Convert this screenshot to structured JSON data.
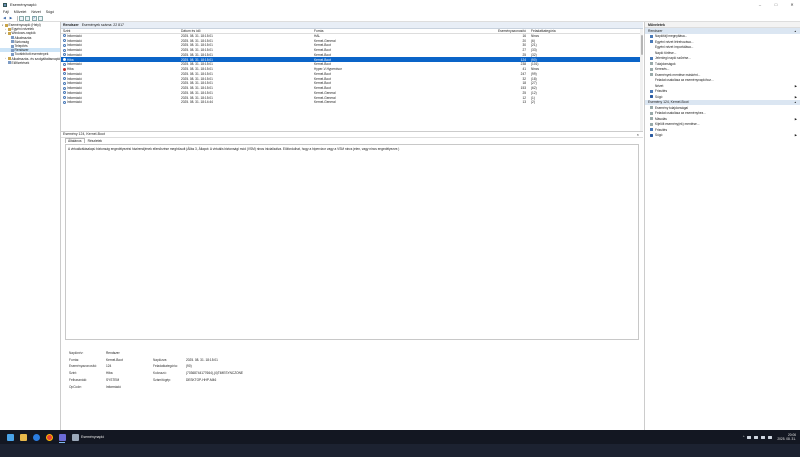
{
  "window": {
    "title": "Eseménynapló",
    "controls": [
      "–",
      "□",
      "✕"
    ]
  },
  "menu": [
    "Fájl",
    "Művelet",
    "Nézet",
    "Súgó"
  ],
  "tree": [
    {
      "label": "Eseménynapló (Helyi)",
      "indent": 0,
      "arrow": "▾",
      "kind": "folder"
    },
    {
      "label": "Egyéni nézetek",
      "indent": 1,
      "arrow": "›",
      "kind": "folder"
    },
    {
      "label": "Windows-naplók",
      "indent": 1,
      "arrow": "▾",
      "kind": "folder"
    },
    {
      "label": "Alkalmazás",
      "indent": 2,
      "arrow": "",
      "kind": "log"
    },
    {
      "label": "Biztonság",
      "indent": 2,
      "arrow": "",
      "kind": "log"
    },
    {
      "label": "Telepítés",
      "indent": 2,
      "arrow": "",
      "kind": "log"
    },
    {
      "label": "Rendszer",
      "indent": 2,
      "arrow": "",
      "kind": "log",
      "selected": true
    },
    {
      "label": "Továbbított események",
      "indent": 2,
      "arrow": "",
      "kind": "log"
    },
    {
      "label": "Alkalmazás- és szolgáltatásnaplók",
      "indent": 1,
      "arrow": "›",
      "kind": "folder"
    },
    {
      "label": "Előfizetések",
      "indent": 1,
      "arrow": "",
      "kind": "log"
    }
  ],
  "events_pane": {
    "log_name": "Rendszer",
    "event_count": "Események száma: 22 817",
    "columns": [
      "Szint",
      "Dátum és idő",
      "Forrás",
      "Eseményazonosító",
      "Feladatkategória"
    ],
    "rows": [
      {
        "level": "Információ",
        "date": "2025. 08. 31. 18:15:01",
        "source": "HAL",
        "id": "16",
        "category": "Nincs"
      },
      {
        "level": "Információ",
        "date": "2025. 08. 31. 18:15:01",
        "source": "Kernel-General",
        "id": "20",
        "category": "(6)"
      },
      {
        "level": "Információ",
        "date": "2025. 08. 31. 18:15:01",
        "source": "Kernel-Boot",
        "id": "30",
        "category": "(21)"
      },
      {
        "level": "Információ",
        "date": "2025. 08. 31. 18:15:01",
        "source": "Kernel-Boot",
        "id": "27",
        "category": "(33)"
      },
      {
        "level": "Információ",
        "date": "2025. 08. 31. 18:15:01",
        "source": "Kernel-Boot",
        "id": "25",
        "category": "(32)"
      },
      {
        "level": "Hiba",
        "date": "2025. 08. 31. 18:15:01",
        "source": "Kernel-Boot",
        "id": "124",
        "category": "(90)",
        "selected": true
      },
      {
        "level": "Információ",
        "date": "2025. 08. 31. 18:15:01",
        "source": "Kernel-Boot",
        "id": "238",
        "category": "(101)"
      },
      {
        "level": "Hiba",
        "date": "2025. 08. 31. 18:15:01",
        "source": "Hyper-V-Hypervisor",
        "id": "41",
        "category": "Nincs"
      },
      {
        "level": "Információ",
        "date": "2025. 08. 31. 18:15:01",
        "source": "Kernel-Boot",
        "id": "247",
        "category": "(99)"
      },
      {
        "level": "Információ",
        "date": "2025. 08. 31. 18:15:01",
        "source": "Kernel-Boot",
        "id": "32",
        "category": "(18)"
      },
      {
        "level": "Információ",
        "date": "2025. 08. 31. 18:15:01",
        "source": "Kernel-Boot",
        "id": "18",
        "category": "(27)"
      },
      {
        "level": "Információ",
        "date": "2025. 08. 31. 18:15:01",
        "source": "Kernel-Boot",
        "id": "153",
        "category": "(62)"
      },
      {
        "level": "Információ",
        "date": "2025. 08. 31. 18:15:01",
        "source": "Kernel-General",
        "id": "25",
        "category": "(12)"
      },
      {
        "level": "Információ",
        "date": "2025. 08. 31. 18:15:01",
        "source": "Kernel-General",
        "id": "12",
        "category": "(1)"
      },
      {
        "level": "Információ",
        "date": "2025. 08. 31. 18:14:44",
        "source": "Kernel-General",
        "id": "13",
        "category": "(2)"
      }
    ]
  },
  "detail": {
    "header": "Esemény 124, Kernel-Boot",
    "tabs": [
      "Általános",
      "Részletek"
    ],
    "message": "A virtualizálásalapú biztonság engedélyezési házirendjének ellenőrzése meghiúsult (Állás 3, Állapot: A virtuális biztonsági mód (VSM) nincs inicializálva. Előfordulhat, hogy a hipervizor vagy a VSM nincs jelen, vagy nincs engedélyezve.)",
    "props": [
      {
        "l1": "Naplónév:",
        "v1": "Rendszer",
        "l2": "",
        "v2": ""
      },
      {
        "l1": "Forrás:",
        "v1": "Kernel-Boot",
        "l2": "Naplózva:",
        "v2": "2025. 08. 31. 18:15:01"
      },
      {
        "l1": "Eseményazonosító:",
        "v1": "124",
        "l2": "Feladatkategória:",
        "v2": "(90)"
      },
      {
        "l1": "Szint:",
        "v1": "Hiba",
        "l2": "Kulcsszó:",
        "v2": "(70368744177664),(4)TIMESYNCZONE"
      },
      {
        "l1": "Felhasználó:",
        "v1": "SYSTEM",
        "l2": "Számítógép:",
        "v2": "DESKTOP-HHP-M46"
      },
      {
        "l1": "OpCode:",
        "v1": "Információ",
        "l2": "",
        "v2": ""
      }
    ]
  },
  "actions": {
    "header": "Műveletek",
    "sections": [
      {
        "title": "Rendszer",
        "items": [
          {
            "label": "Naplófájl megnyitása...",
            "icon": "folder-open-icon",
            "cls": "blue"
          },
          {
            "label": "Egyéni nézet létrehozása...",
            "icon": "filter-icon",
            "cls": "blue"
          },
          {
            "label": "Egyéni nézet importálása...",
            "icon": "",
            "cls": "blank"
          },
          {
            "label": "Napló törlése...",
            "icon": "",
            "cls": "blank"
          },
          {
            "label": "Jelenlegi napló szűrése...",
            "icon": "filter-icon",
            "cls": "blue"
          },
          {
            "label": "Tulajdonságok",
            "icon": "properties-icon",
            "cls": "gray"
          },
          {
            "label": "Keresés...",
            "icon": "binoculars-icon",
            "cls": "gray"
          },
          {
            "label": "Események mentése másként...",
            "icon": "save-icon",
            "cls": "gray"
          },
          {
            "label": "Feladat csatolása az eseménynaplóhoz...",
            "icon": "",
            "cls": "blank"
          },
          {
            "label": "Nézet",
            "icon": "",
            "cls": "blank",
            "submenu": true
          },
          {
            "label": "Frissítés",
            "icon": "refresh-icon",
            "cls": "blue"
          },
          {
            "label": "Súgó",
            "icon": "help-icon",
            "cls": "help",
            "submenu": true
          }
        ]
      },
      {
        "title": "Esemény 124, Kernel-Boot",
        "items": [
          {
            "label": "Esemény tulajdonságai",
            "icon": "properties-icon",
            "cls": "gray"
          },
          {
            "label": "Feladat csatolása az eseményhez...",
            "icon": "task-icon",
            "cls": "gray"
          },
          {
            "label": "Másolás",
            "icon": "copy-icon",
            "cls": "gray",
            "submenu": true
          },
          {
            "label": "Kijelölt esemény(ek) mentése...",
            "icon": "save-icon",
            "cls": "gray"
          },
          {
            "label": "Frissítés",
            "icon": "refresh-icon",
            "cls": "blue"
          },
          {
            "label": "Súgó",
            "icon": "help-icon",
            "cls": "help",
            "submenu": true
          }
        ]
      }
    ]
  },
  "taskbar": {
    "app_label": "Eseménynapló",
    "time": "20:06",
    "date": "2025. 08. 31."
  }
}
